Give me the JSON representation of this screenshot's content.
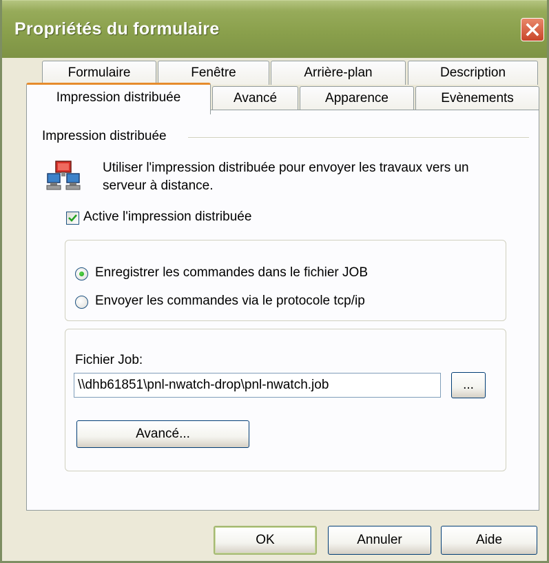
{
  "window": {
    "title": "Propriétés du formulaire"
  },
  "tabs": {
    "row1": [
      "Formulaire",
      "Fenêtre",
      "Arrière-plan",
      "Description"
    ],
    "row2": [
      "Impression distribuée",
      "Avancé",
      "Apparence",
      "Evènements"
    ],
    "active": "Impression distribuée"
  },
  "panel": {
    "group_label": "Impression distribuée",
    "description_line1": "Utiliser l'impression distribuée pour envoyer les travaux vers un",
    "description_line2": "serveur à distance.",
    "icon": "network-computers-icon",
    "checkbox": {
      "label": "Active l'impression distribuée",
      "checked": true
    },
    "radios": [
      {
        "label": "Enregistrer les commandes dans le fichier JOB",
        "selected": true
      },
      {
        "label": "Envoyer les commandes via le protocole tcp/ip",
        "selected": false
      }
    ],
    "job_file": {
      "label": "Fichier Job:",
      "value": "\\\\dhb61851\\pnl-nwatch-drop\\pnl-nwatch.job",
      "browse_label": "...",
      "advanced_label": "Avancé..."
    }
  },
  "footer": {
    "ok": "OK",
    "cancel": "Annuler",
    "help": "Aide"
  },
  "colors": {
    "titlebar": "#8aa04c",
    "window_bg": "#ece9d8",
    "active_tab_accent": "#e68b2c",
    "close_button": "#c9462a"
  }
}
